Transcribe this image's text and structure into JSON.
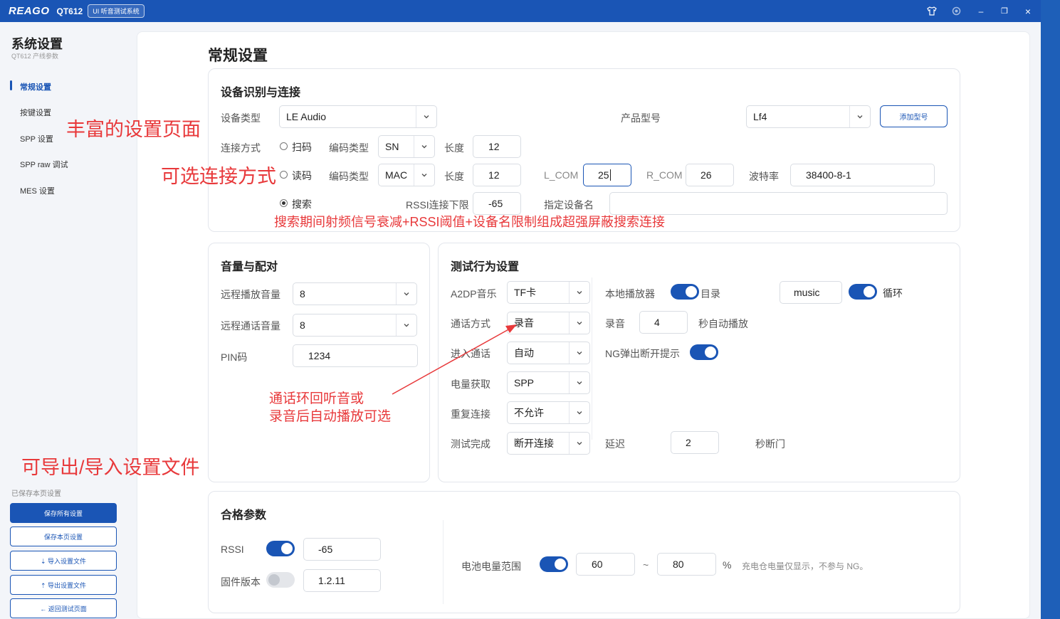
{
  "titlebar": {
    "logo": "REAGO",
    "app_name": "QT612",
    "badge": "UI 听音测试系统",
    "shirt_icon": "shirt-icon",
    "settings_icon": "gear-icon",
    "min": "–",
    "max": "❐",
    "close": "×"
  },
  "sidebar": {
    "title": "系统设置",
    "subtitle": "QT612 产线参数",
    "items": [
      {
        "label": "常规设置"
      },
      {
        "label": "按键设置"
      },
      {
        "label": "SPP 设置"
      },
      {
        "label": "SPP raw 调试"
      },
      {
        "label": "MES 设置"
      }
    ],
    "saved_note": "已保存本页设置",
    "buttons": {
      "save_all": "保存所有设置",
      "save_page": "保存本页设置",
      "import": "⇣ 导入设置文件",
      "export": "⇡ 导出设置文件",
      "back": "← 返回测试页面"
    }
  },
  "main": {
    "title": "常规设置",
    "device": {
      "title": "设备识别与连接",
      "device_type_label": "设备类型",
      "device_type_value": "LE Audio",
      "product_model_label": "产品型号",
      "product_model_value": "Lf4",
      "add_model_button": "添加型号",
      "conn_mode_label": "连接方式",
      "scan_label": "扫码",
      "read_label": "读码",
      "search_label": "搜索",
      "code_type_label": "编码类型",
      "code_type_1": "SN",
      "code_type_2": "MAC",
      "length_label": "长度",
      "length_1": "12",
      "length_2": "12",
      "lcom_label": "L_COM",
      "lcom_value": "25",
      "rcom_label": "R_COM",
      "rcom_value": "26",
      "baud_label": "波特率",
      "baud_value": "38400-8-1",
      "rssi_limit_label": "RSSI连接下限",
      "rssi_limit_value": "-65",
      "device_name_label": "指定设备名",
      "device_name_value": ""
    },
    "volume": {
      "title": "音量与配对",
      "remote_play_label": "远程播放音量",
      "remote_play_value": "8",
      "remote_call_label": "远程通话音量",
      "remote_call_value": "8",
      "pin_label": "PIN码",
      "pin_value": "1234"
    },
    "behavior": {
      "title": "测试行为设置",
      "a2dp_label": "A2DP音乐",
      "a2dp_value": "TF卡",
      "local_player_label": "本地播放器",
      "dir_label": "目录",
      "dir_value": "music",
      "loop_label": "循环",
      "call_mode_label": "通话方式",
      "call_mode_value": "录音",
      "record_label": "录音",
      "record_value": "4",
      "auto_play_label": "秒自动播放",
      "enter_call_label": "进入通话",
      "enter_call_value": "自动",
      "ng_label": "NG弹出断开提示",
      "battery_get_label": "电量获取",
      "battery_get_value": "SPP",
      "reconnect_label": "重复连接",
      "reconnect_value": "不允许",
      "test_done_label": "测试完成",
      "test_done_value": "断开连接",
      "delay_label": "延迟",
      "delay_value": "2",
      "delay_unit": "秒断门"
    },
    "pass": {
      "title": "合格参数",
      "rssi_label": "RSSI",
      "rssi_value": "-65",
      "fw_label": "固件版本",
      "fw_value": "1.2.11",
      "battery_range_label": "电池电量范围",
      "battery_min": "60",
      "tilde": "~",
      "battery_max": "80",
      "percent": "%",
      "battery_note": "充电仓电量仅显示，不参与 NG。"
    }
  },
  "annotations": {
    "a1": "丰富的设置页面",
    "a2": "可选连接方式",
    "a3": "搜索期间射频信号衰减+RSSI阈值+设备名限制组成超强屏蔽搜索连接",
    "a4_line1": "通话环回听音或",
    "a4_line2": "录音后自动播放可选",
    "a5": "可导出/导入设置文件"
  },
  "colors": {
    "accent": "#1a55b5",
    "annotation": "#e8393b"
  }
}
